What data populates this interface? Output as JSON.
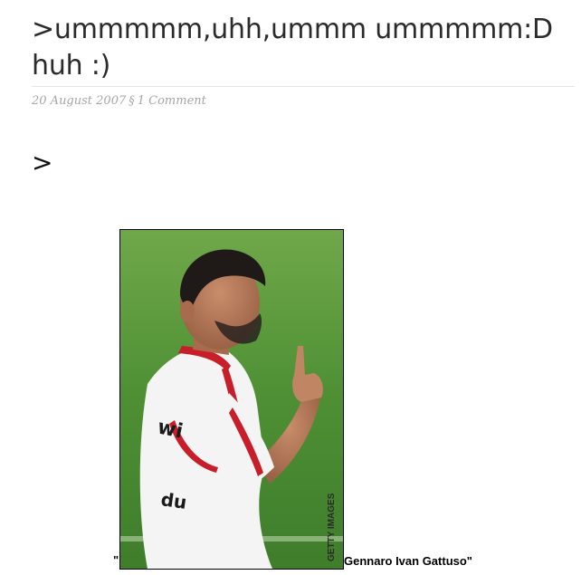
{
  "post": {
    "title": ">ummmmm,uhh,ummm ummmmm:D huh :)",
    "date": "20 August 2007",
    "separator": "§",
    "comments": "1 Comment",
    "body_text": ">"
  },
  "figure": {
    "quote_open": "\"",
    "caption": "Gennaro Ivan Gattuso\"",
    "credit": "GETTY IMAGES"
  }
}
